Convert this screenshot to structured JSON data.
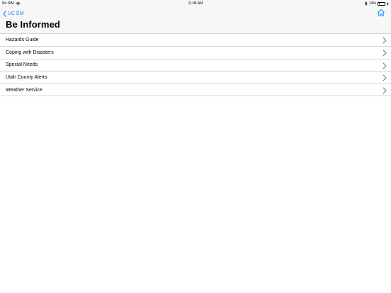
{
  "status_bar": {
    "carrier": "No SIM",
    "time": "11:45 AM",
    "battery_percent": "14%",
    "battery_level": 0.14
  },
  "nav": {
    "back_label": "UC EM",
    "title": "Be Informed"
  },
  "list": {
    "items": [
      {
        "label": "Hazards Guide"
      },
      {
        "label": "Coping with Disasters"
      },
      {
        "label": "Special Needs"
      },
      {
        "label": "Utah County Alerts"
      },
      {
        "label": "Weather Service"
      }
    ]
  },
  "colors": {
    "accent": "#1a82fb",
    "chevron": "#6b6b70",
    "separator": "#d4d4d8",
    "header_bg": "#f7f7f7"
  },
  "icons": {
    "wifi": "wifi-icon",
    "bluetooth": "bluetooth-icon",
    "battery": "battery-icon",
    "charging": "charging-bolt-icon",
    "back": "chevron-left-icon",
    "home": "home-icon",
    "row_chevron": "chevron-right-icon"
  }
}
